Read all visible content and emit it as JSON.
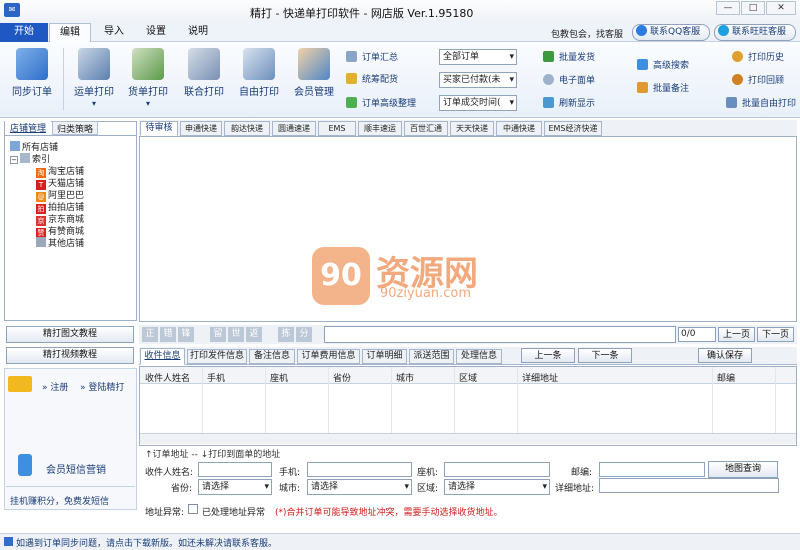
{
  "app": {
    "title": "精打 - 快递单打印软件 - 网店版 Ver.1.95180"
  },
  "menu": {
    "tabs": [
      "开始",
      "编辑",
      "导入",
      "设置",
      "说明"
    ]
  },
  "header_right": {
    "promo": "包教包会，找客服",
    "qq_btn": "联系QQ客服",
    "ww_btn": "联系旺旺客服"
  },
  "ribbon": {
    "sync": "同步订单",
    "big": [
      "运单打印",
      "货单打印",
      "联合打印",
      "自由打印",
      "会员管理"
    ],
    "col1": [
      "订单汇总",
      "统筹配货",
      "订单高级整理"
    ],
    "combos": [
      "全部订单",
      "买家已付款(未",
      "订单成交时间("
    ],
    "col2": [
      "批量发货",
      "电子面单",
      "刷新显示"
    ],
    "col3": [
      "高级搜索",
      "批量备注"
    ],
    "col4": [
      "打印历史",
      "打印回顾",
      "批量自由打印"
    ]
  },
  "sidebar": {
    "tabs": [
      "店铺管理",
      "归类策略"
    ],
    "tree": {
      "root": "所有店铺",
      "node": "索引",
      "shops": [
        "淘宝店铺",
        "天猫店铺",
        "阿里巴巴",
        "拍拍店铺",
        "京东商城",
        "有赞商城",
        "其他店铺"
      ]
    },
    "buttons": [
      "精打图文教程",
      "精打视频教程"
    ],
    "register": "» 注册",
    "login": "» 登陆精打",
    "sms": "会员短信营销",
    "footer": "挂机赚积分，免费发短信"
  },
  "carriers": [
    "待审核",
    "申通快递",
    "韵达快递",
    "圆通速递",
    "EMS",
    "顺丰速运",
    "百世汇通",
    "天天快递",
    "中通快递",
    "EMS经济快递"
  ],
  "watermark": {
    "logo": "资源网",
    "logo_num": "90",
    "url": "90ziyuan.com"
  },
  "toolbar2": {
    "quick": [
      "正",
      "错",
      "锋",
      "留",
      "世",
      "返",
      "拣",
      "分"
    ],
    "page": "0/0",
    "prev": "上一页",
    "next": "下一页"
  },
  "detail_tabs": [
    "收件信息",
    "打印发件信息",
    "备注信息",
    "订单费用信息",
    "订单明细",
    "派送范围",
    "处理信息"
  ],
  "detail_btns": {
    "prev": "上一条",
    "next": "下一条",
    "save": "确认保存"
  },
  "grid_headers": [
    "收件人姓名",
    "手机",
    "座机",
    "省份",
    "城市",
    "区域",
    "详细地址",
    "邮编"
  ],
  "hint": "↑订单地址 -- ↓打印到面单的地址",
  "form": {
    "name": "收件人姓名:",
    "mobile": "手机:",
    "phone": "座机:",
    "zip": "邮编:",
    "map_btn": "地图查询",
    "prov": "省份:",
    "city": "城市:",
    "area": "区域:",
    "addr": "详细地址:",
    "select": "请选择",
    "abnormal": "地址异常:",
    "handled": "已处理地址异常",
    "warn": "(*)合并订单可能导致地址冲突，需要手动选择收货地址。"
  },
  "status": "如遇到订单同步问题，请点击下载新版。如还未解决请联系客服。",
  "colors": {
    "accent": "#1f57c3",
    "warn": "#d11a1a",
    "wm": "#f0a070"
  }
}
